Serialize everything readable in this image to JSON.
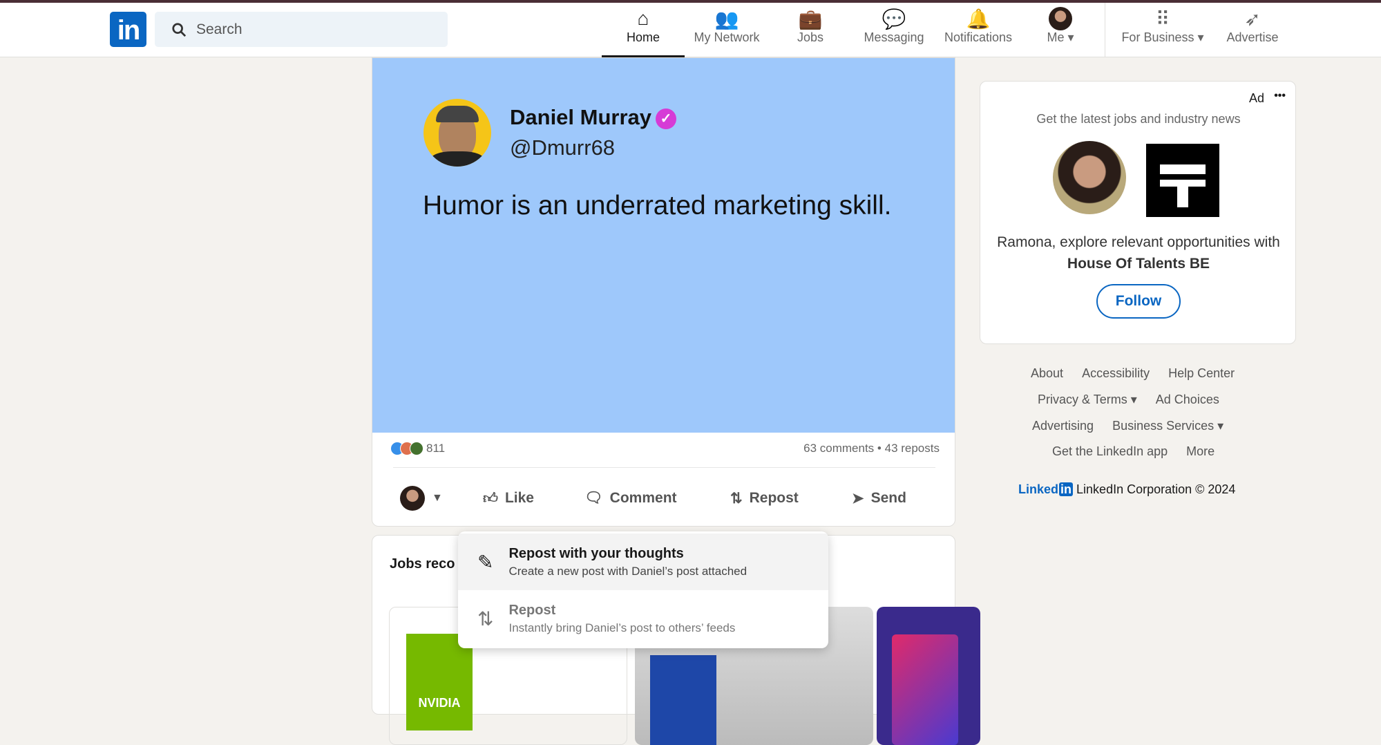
{
  "nav": {
    "logo": "in",
    "search_placeholder": "Search",
    "items": [
      {
        "label": "Home",
        "icon": "home-icon"
      },
      {
        "label": "My Network",
        "icon": "people-icon"
      },
      {
        "label": "Jobs",
        "icon": "briefcase-icon"
      },
      {
        "label": "Messaging",
        "icon": "chat-icon"
      },
      {
        "label": "Notifications",
        "icon": "bell-icon"
      },
      {
        "label": "Me",
        "icon": "avatar"
      },
      {
        "label": "For Business",
        "icon": "grid-icon"
      },
      {
        "label": "Advertise",
        "icon": "compass-icon"
      }
    ]
  },
  "post": {
    "tweet": {
      "name": "Daniel Murray",
      "handle": "@Dmurr68",
      "text": "Humor is an underrated marketing skill."
    },
    "reactions_count": "811",
    "comments": "63 comments",
    "reposts": "43 reposts",
    "dot": "•",
    "actions": {
      "like": "Like",
      "comment": "Comment",
      "repost": "Repost",
      "send": "Send"
    }
  },
  "jobs": {
    "title": "Jobs reco",
    "nvidia": "NVIDIA"
  },
  "repost_menu": [
    {
      "title": "Repost with your thoughts",
      "subtitle": "Create a new post with Daniel’s post attached"
    },
    {
      "title": "Repost",
      "subtitle": "Instantly bring Daniel’s post to others’ feeds"
    }
  ],
  "ad": {
    "label": "Ad",
    "more": "•••",
    "headline": "Get the latest jobs and industry news",
    "body": "Ramona, explore relevant opportunities with",
    "company": "House Of Talents BE",
    "follow": "Follow"
  },
  "footer": {
    "row1": [
      "About",
      "Accessibility",
      "Help Center"
    ],
    "row2": [
      "Privacy & Terms",
      "Ad Choices"
    ],
    "row3": [
      "Advertising",
      "Business Services"
    ],
    "row4": [
      "Get the LinkedIn app",
      "More"
    ],
    "brand": "Linked",
    "brand_in": "in",
    "copyright": "LinkedIn Corporation © 2024"
  },
  "colors": {
    "brand": "#0a66c2",
    "tweet_bg": "#9ec8fb",
    "verified": "#d63bd6"
  }
}
